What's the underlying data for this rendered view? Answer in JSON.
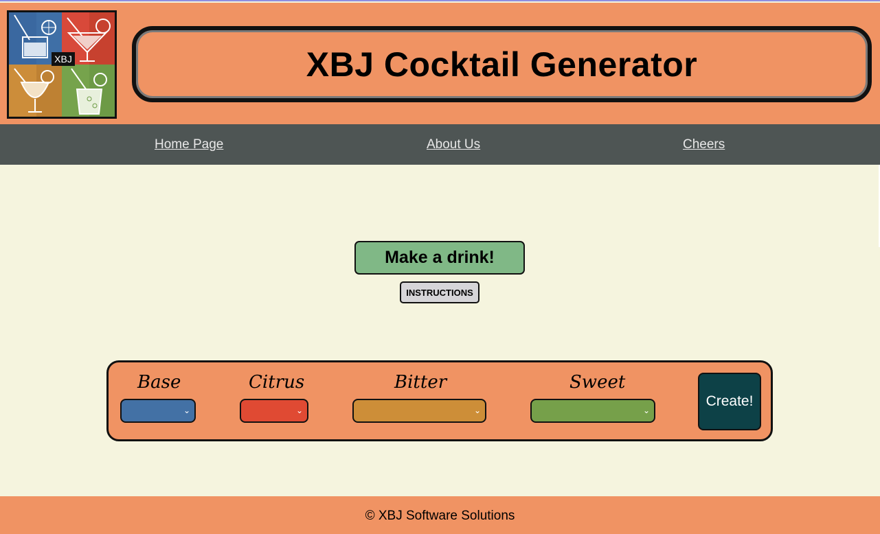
{
  "header": {
    "logo_badge": "XBJ",
    "title": "XBJ Cocktail Generator"
  },
  "nav": {
    "items": [
      "Home Page",
      "About Us",
      "Cheers"
    ]
  },
  "main": {
    "make_drink_label": "Make a drink!",
    "instructions_label": "INSTRUCTIONS"
  },
  "panel": {
    "fields": [
      {
        "label": "Base",
        "color": "#4371a5",
        "value": ""
      },
      {
        "label": "Citrus",
        "color": "#e04a33",
        "value": ""
      },
      {
        "label": "Bitter",
        "color": "#cd8e38",
        "value": ""
      },
      {
        "label": "Sweet",
        "color": "#76a04a",
        "value": ""
      }
    ],
    "create_label": "Create!"
  },
  "footer": {
    "text": "© XBJ Software Solutions"
  },
  "colors": {
    "header_bg": "#f09363",
    "nav_bg": "#4e5554",
    "page_bg": "#f5f4de",
    "make_button": "#80b886",
    "create_button": "#0d4147"
  }
}
